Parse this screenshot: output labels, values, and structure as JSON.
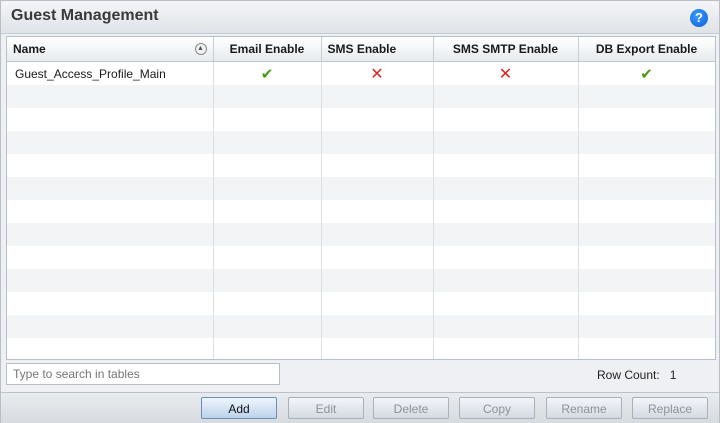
{
  "panel": {
    "title": "Guest Management",
    "help_label": "?"
  },
  "table": {
    "columns": [
      "Name",
      "Email Enable",
      "SMS Enable",
      "SMS SMTP Enable",
      "DB Export Enable"
    ],
    "rows": [
      {
        "name": "Guest_Access_Profile_Main",
        "email_enable": "✔",
        "sms_enable": "✕",
        "sms_smtp_enable": "✕",
        "db_export_enable": "✔"
      }
    ]
  },
  "search": {
    "placeholder": "Type to search in tables"
  },
  "row_count": {
    "label": "Row Count:",
    "value": "1"
  },
  "buttons": {
    "add": "Add",
    "edit": "Edit",
    "delete": "Delete",
    "copy": "Copy",
    "rename": "Rename",
    "replace": "Replace"
  },
  "colors": {
    "check": "#4a9a12",
    "cross": "#e0261b",
    "help": "#0a5fd8"
  }
}
